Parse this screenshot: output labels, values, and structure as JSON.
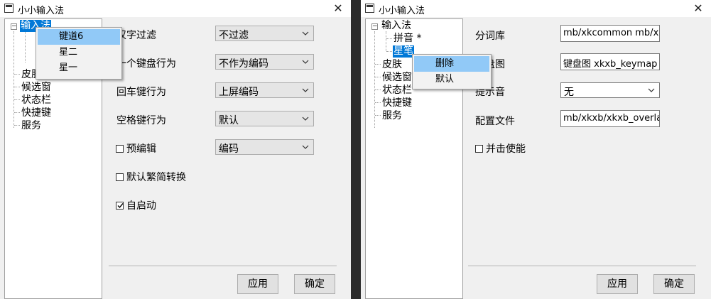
{
  "window1": {
    "title": "小小输入法",
    "close_glyph": "✕",
    "tree": {
      "root": "输入法",
      "items": [
        "皮肤",
        "候选窗",
        "状态栏",
        "快捷键",
        "服务"
      ]
    },
    "context_menu": {
      "items": [
        "键道6",
        "星二",
        "星一"
      ],
      "highlighted_index": 0
    },
    "settings": {
      "hanzi_filter": {
        "label": "汉字过滤",
        "value": "不过滤"
      },
      "key_behavior": {
        "label": "一个键盘行为",
        "value": "不作为编码"
      },
      "enter_behavior": {
        "label": "回车键行为",
        "value": "上屏编码"
      },
      "space_behavior": {
        "label": "空格键行为",
        "value": "默认"
      },
      "preedit": {
        "label": "预编辑",
        "value": "编码",
        "checked": false
      },
      "default_trad": {
        "label": "默认繁简转换",
        "checked": false
      },
      "autostart": {
        "label": "自启动",
        "checked": true
      }
    },
    "buttons": {
      "apply": "应用",
      "ok": "确定"
    }
  },
  "window2": {
    "title": "小小输入法",
    "close_glyph": "✕",
    "tree": {
      "root": "输入法",
      "children": [
        "拼音 *",
        "星笔"
      ],
      "items": [
        "皮肤",
        "候选窗",
        "状态栏",
        "快捷键",
        "服务"
      ]
    },
    "context_menu": {
      "items": [
        "删除",
        "默认"
      ],
      "highlighted_index": 0
    },
    "settings": {
      "dict": {
        "label": "分词库",
        "value": "mb/xkcommon mb/xkxb"
      },
      "keymap": {
        "label": "键盘图",
        "value": "键盘图 xkxb_keymap"
      },
      "tone": {
        "label": "提示音",
        "value": "无"
      },
      "config": {
        "label": "配置文件",
        "value": "mb/xkxb/xkxb_overlay"
      },
      "chord": {
        "label": "并击使能",
        "checked": false
      }
    },
    "buttons": {
      "apply": "应用",
      "ok": "确定"
    }
  },
  "colors": {
    "selection": "#0078d7",
    "menu_highlight": "#91c9f7",
    "window_bg": "#f0f0f0"
  }
}
